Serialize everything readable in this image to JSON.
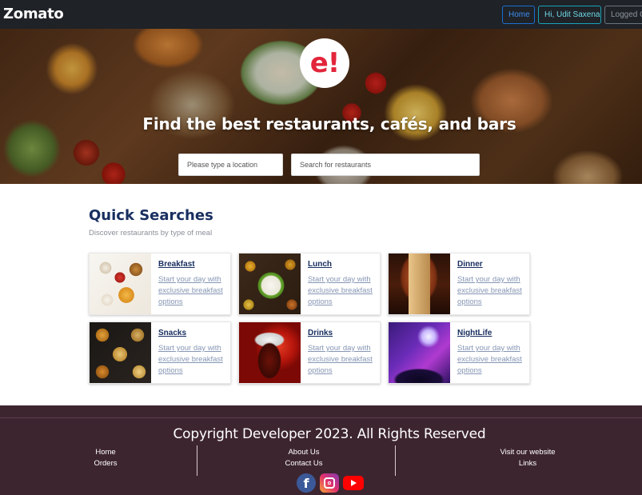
{
  "navbar": {
    "brand": "Zomato",
    "home_label": "Home",
    "user_label": "Hi, Udit Saxena",
    "logout_label": "Logged Out"
  },
  "hero": {
    "logo": "e!",
    "title": "Find the best restaurants, cafés, and bars",
    "location_placeholder": "Please type a location",
    "search_placeholder": "Search for restaurants"
  },
  "quick_searches": {
    "title": "Quick Searches",
    "subtitle": "Discover restaurants by type of meal",
    "cards": [
      {
        "title": "Breakfast",
        "description": "Start your day with exclusive breakfast options",
        "image": "breakfast-image"
      },
      {
        "title": "Lunch",
        "description": "Start your day with exclusive breakfast options",
        "image": "lunch-image"
      },
      {
        "title": "Dinner",
        "description": "Start your day with exclusive breakfast options",
        "image": "dinner-image"
      },
      {
        "title": "Snacks",
        "description": "Start your day with exclusive breakfast options",
        "image": "snacks-image"
      },
      {
        "title": "Drinks",
        "description": "Start your day with exclusive breakfast options",
        "image": "drinks-image"
      },
      {
        "title": "NightLife",
        "description": "Start your day with exclusive breakfast options",
        "image": "nightlife-image"
      }
    ]
  },
  "footer": {
    "copyright": "Copyright Developer 2023. All Rights Reserved",
    "col1": [
      "Home",
      "Orders"
    ],
    "col2": [
      "About Us",
      "Contact Us"
    ],
    "col3": [
      "Visit our website",
      "Links"
    ],
    "social": {
      "facebook_letter": "f",
      "icons": [
        "facebook-icon",
        "instagram-icon",
        "youtube-icon"
      ]
    }
  },
  "colors": {
    "navbar_bg": "#1f2227",
    "accent_red": "#e2253b",
    "heading_navy": "#192f60",
    "footer_bg": "#3d2530"
  }
}
